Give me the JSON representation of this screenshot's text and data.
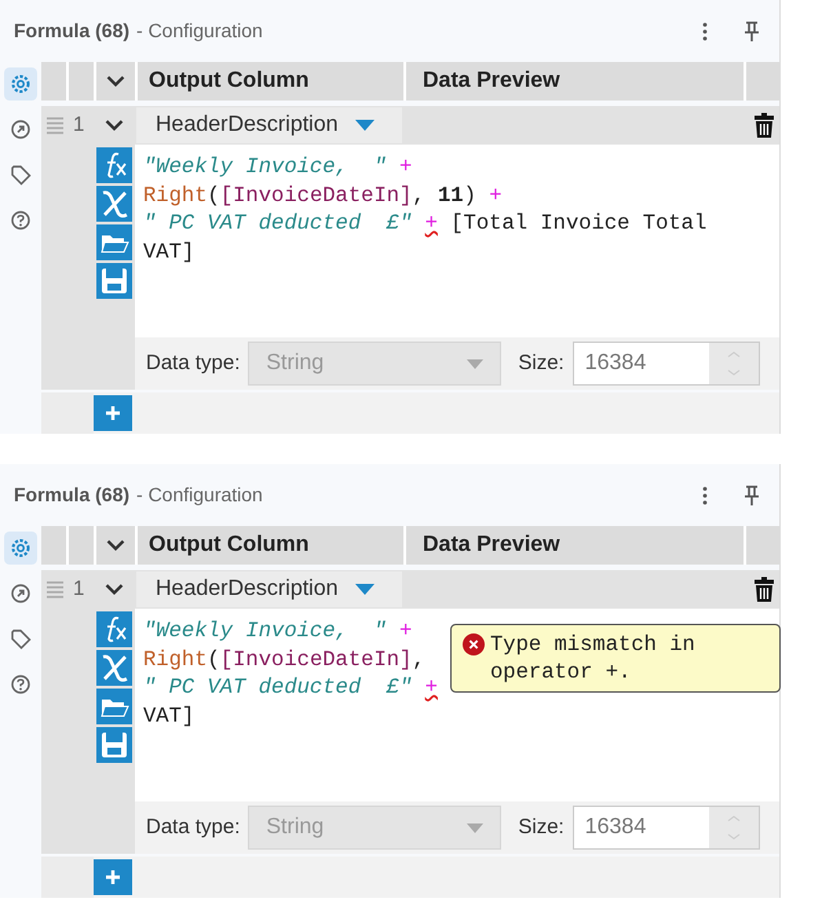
{
  "panels": [
    {
      "title": "Formula (68)",
      "subtitle": "- Configuration",
      "sidebar": [
        {
          "kind": "settings",
          "selected": true
        },
        {
          "kind": "output",
          "selected": false
        },
        {
          "kind": "tag",
          "selected": false
        },
        {
          "kind": "help",
          "selected": false
        }
      ],
      "columns": [
        "Output Column",
        "Data Preview"
      ],
      "rows": [
        {
          "number": "1",
          "expanded": true,
          "output_column": "HeaderDescription",
          "code": [
            [
              {
                "kind": "string",
                "text": "\"Weekly Invoice,  \" "
              },
              {
                "kind": "operator",
                "text": "+"
              }
            ],
            [
              {
                "kind": "function",
                "text": "Right"
              },
              {
                "kind": "plain",
                "text": "("
              },
              {
                "kind": "field",
                "text": "[InvoiceDateIn]"
              },
              {
                "kind": "plain",
                "text": ", "
              },
              {
                "kind": "number",
                "text": "11"
              },
              {
                "kind": "plain",
                "text": ") "
              },
              {
                "kind": "operator",
                "text": "+"
              }
            ],
            [
              {
                "kind": "string",
                "text": "\" PC VAT deducted  £\" "
              },
              {
                "kind": "error_operator",
                "text": "+"
              },
              {
                "kind": "plain",
                "text": " [Total Invoice Total"
              }
            ],
            [
              {
                "kind": "plain",
                "text": "VAT]"
              }
            ]
          ],
          "data_type_label": "Data type:",
          "data_type": "String",
          "size_label": "Size:",
          "size": "16384"
        }
      ]
    },
    {
      "title": "Formula (68)",
      "subtitle": "- Configuration",
      "sidebar": [
        {
          "kind": "settings",
          "selected": true
        },
        {
          "kind": "output",
          "selected": false
        },
        {
          "kind": "tag",
          "selected": false
        },
        {
          "kind": "help",
          "selected": false
        }
      ],
      "columns": [
        "Output Column",
        "Data Preview"
      ],
      "rows": [
        {
          "number": "1",
          "expanded": true,
          "output_column": "HeaderDescription",
          "code": [
            [
              {
                "kind": "string",
                "text": "\"Weekly Invoice,  \" "
              },
              {
                "kind": "operator",
                "text": "+"
              }
            ],
            [
              {
                "kind": "function",
                "text": "Right"
              },
              {
                "kind": "plain",
                "text": "("
              },
              {
                "kind": "field",
                "text": "[InvoiceDateIn]"
              },
              {
                "kind": "plain",
                "text": ","
              }
            ],
            [
              {
                "kind": "string",
                "text": "\" PC VAT deducted  £\" "
              },
              {
                "kind": "error_operator",
                "text": "+"
              }
            ],
            [
              {
                "kind": "plain",
                "text": "VAT]"
              }
            ]
          ],
          "data_type_label": "Data type:",
          "data_type": "String",
          "size_label": "Size:",
          "size": "16384"
        }
      ],
      "tooltip": {
        "message": "Type mismatch in operator +."
      }
    }
  ]
}
